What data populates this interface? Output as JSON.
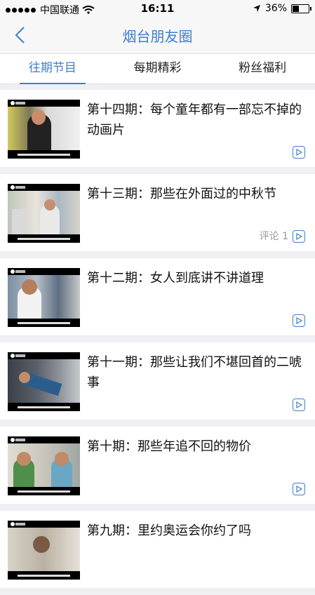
{
  "status": {
    "carrier": "中国联通",
    "time": "16:11",
    "battery": "36%"
  },
  "nav": {
    "title": "烟台朋友圈"
  },
  "tabs": [
    {
      "label": "往期节目"
    },
    {
      "label": "每期精彩"
    },
    {
      "label": "粉丝福利"
    }
  ],
  "episodes": [
    {
      "title": "第十四期：每个童年都有一部忘不掉的动画片",
      "comment": ""
    },
    {
      "title": "第十三期：那些在外面过的中秋节",
      "comment": "评论 1"
    },
    {
      "title": "第十二期：女人到底讲不讲道理",
      "comment": ""
    },
    {
      "title": "第十一期：那些让我们不堪回首的二唬事",
      "comment": ""
    },
    {
      "title": "第十期：那些年追不回的物价",
      "comment": ""
    },
    {
      "title": "第九期：里约奥运会你约了吗",
      "comment": ""
    }
  ],
  "colors": {
    "accent": "#3d7fcf"
  }
}
